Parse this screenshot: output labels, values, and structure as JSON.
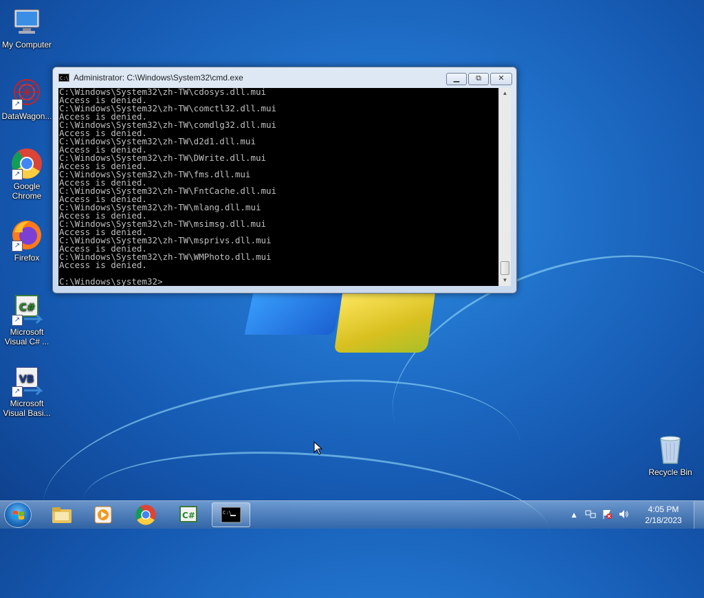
{
  "desktop": {
    "icons": [
      {
        "label": "My Computer"
      },
      {
        "label": "DataWagon..."
      },
      {
        "label": "Google Chrome"
      },
      {
        "label": "Firefox"
      },
      {
        "label": "Microsoft Visual C# ..."
      },
      {
        "label": "Microsoft Visual Basi..."
      },
      {
        "label": "Recycle Bin"
      }
    ]
  },
  "window": {
    "title": "Administrator: C:\\Windows\\System32\\cmd.exe",
    "console_text": "C:\\Windows\\System32\\zh-TW\\cdosys.dll.mui\nAccess is denied.\nC:\\Windows\\System32\\zh-TW\\comctl32.dll.mui\nAccess is denied.\nC:\\Windows\\System32\\zh-TW\\comdlg32.dll.mui\nAccess is denied.\nC:\\Windows\\System32\\zh-TW\\d2d1.dll.mui\nAccess is denied.\nC:\\Windows\\System32\\zh-TW\\DWrite.dll.mui\nAccess is denied.\nC:\\Windows\\System32\\zh-TW\\fms.dll.mui\nAccess is denied.\nC:\\Windows\\System32\\zh-TW\\FntCache.dll.mui\nAccess is denied.\nC:\\Windows\\System32\\zh-TW\\mlang.dll.mui\nAccess is denied.\nC:\\Windows\\System32\\zh-TW\\msimsg.dll.mui\nAccess is denied.\nC:\\Windows\\System32\\zh-TW\\msprivs.dll.mui\nAccess is denied.\nC:\\Windows\\System32\\zh-TW\\WMPhoto.dll.mui\nAccess is denied.\n\nC:\\Windows\\system32>"
  },
  "taskbar": {
    "clock_time": "4:05 PM",
    "clock_date": "2/18/2023"
  }
}
